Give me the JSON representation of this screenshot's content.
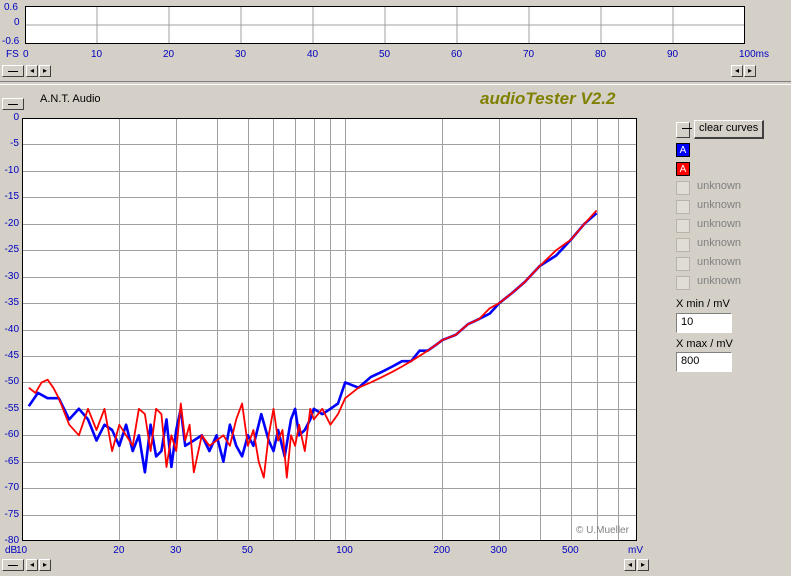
{
  "top_plot": {
    "y_ticks": [
      "0.6",
      "0",
      "-0.6"
    ],
    "x_ticks": [
      "0",
      "10",
      "20",
      "30",
      "40",
      "50",
      "60",
      "70",
      "80",
      "90",
      "100ms"
    ],
    "x_label": "FS"
  },
  "header": {
    "brand": "A.N.T. Audio",
    "title": "audioTester V2.2"
  },
  "controls": {
    "clear_curves": "clear curves",
    "channel_a": "A",
    "channel_b": "A",
    "unknown_items": [
      "unknown",
      "unknown",
      "unknown",
      "unknown",
      "unknown",
      "unknown"
    ],
    "xmin_label": "X min / mV",
    "xmin_value": "10",
    "xmax_label": "X max / mV",
    "xmax_value": "800"
  },
  "colors": {
    "blue": "#0000ff",
    "red": "#ff0000",
    "title": "#808000"
  },
  "copyright": "© U.Mueller",
  "chart_data": {
    "type": "line",
    "x_scale": "log",
    "xlim": [
      10,
      800
    ],
    "ylim": [
      -80,
      0
    ],
    "xlabel": "mV",
    "ylabel": "dB",
    "y_ticks": [
      0,
      -5,
      -10,
      -15,
      -20,
      -25,
      -30,
      -35,
      -40,
      -45,
      -50,
      -55,
      -60,
      -65,
      -70,
      -75,
      -80
    ],
    "x_ticks": [
      10,
      20,
      30,
      50,
      100,
      200,
      300,
      500
    ],
    "x_tick_labels": [
      "10",
      "20",
      "30",
      "50",
      "100",
      "200",
      "300",
      "500"
    ],
    "series": [
      {
        "color": "#0000ff",
        "x": [
          10.5,
          11.2,
          12,
          13,
          14,
          15,
          16,
          17,
          18,
          19,
          20,
          21,
          22,
          23,
          24,
          25,
          26,
          27,
          28,
          29,
          30,
          31,
          32,
          34,
          36,
          38,
          40,
          42,
          44,
          46,
          48,
          50,
          52,
          55,
          58,
          60,
          62,
          65,
          68,
          70,
          72,
          75,
          78,
          80,
          85,
          90,
          95,
          100,
          110,
          120,
          130,
          140,
          150,
          160,
          170,
          180,
          190,
          200,
          220,
          240,
          260,
          280,
          300,
          330,
          360,
          400,
          450,
          500,
          550,
          600
        ],
        "y": [
          -54.5,
          -52,
          -53,
          -53,
          -57,
          -55,
          -57,
          -61,
          -58,
          -59,
          -62,
          -58,
          -63,
          -60,
          -67,
          -58,
          -64,
          -63,
          -57,
          -66,
          -59,
          -55,
          -62,
          -61,
          -60,
          -63,
          -60,
          -65,
          -58,
          -62,
          -64,
          -60,
          -62,
          -56,
          -61,
          -63,
          -59,
          -64,
          -57,
          -55,
          -60,
          -59,
          -57,
          -55,
          -56,
          -55,
          -54,
          -50,
          -51,
          -49,
          -48,
          -47,
          -46,
          -46,
          -44,
          -44,
          -43,
          -42,
          -41,
          -39,
          -38,
          -37,
          -35,
          -33,
          -31,
          -28,
          -26,
          -23,
          -20,
          -18
        ]
      },
      {
        "color": "#ff0000",
        "x": [
          10.5,
          11,
          11.5,
          12,
          12.5,
          13,
          14,
          15,
          16,
          17,
          18,
          19,
          20,
          21,
          22,
          23,
          24,
          25,
          26,
          27,
          28,
          29,
          30,
          31,
          32,
          33,
          34,
          36,
          38,
          40,
          42,
          44,
          46,
          48,
          50,
          52,
          54,
          56,
          58,
          60,
          62,
          64,
          66,
          68,
          70,
          72,
          75,
          78,
          80,
          85,
          90,
          95,
          100,
          110,
          120,
          130,
          140,
          150,
          160,
          170,
          180,
          190,
          200,
          220,
          240,
          260,
          280,
          300,
          330,
          360,
          400,
          450,
          500,
          550,
          600
        ],
        "y": [
          -51,
          -52,
          -50,
          -49.5,
          -51,
          -53,
          -58,
          -60,
          -55,
          -59,
          -55,
          -63,
          -58,
          -60,
          -62,
          -55,
          -56,
          -63,
          -55,
          -56,
          -66,
          -60,
          -63,
          -54,
          -61,
          -58,
          -67,
          -60,
          -62,
          -61,
          -60,
          -62,
          -57,
          -54,
          -62,
          -59,
          -65,
          -68,
          -60,
          -55,
          -61,
          -59,
          -68,
          -60,
          -62,
          -58,
          -63,
          -55,
          -57,
          -55,
          -58,
          -56,
          -53,
          -51,
          -50,
          -49,
          -48,
          -47,
          -46,
          -45,
          -44,
          -43,
          -42,
          -41,
          -39,
          -38,
          -36,
          -35,
          -33,
          -31,
          -28,
          -25,
          -23,
          -20,
          -17.5
        ]
      }
    ]
  }
}
